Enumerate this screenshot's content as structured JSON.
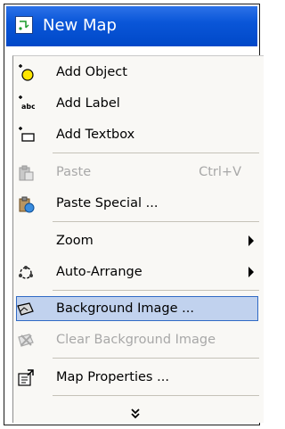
{
  "window": {
    "title": "New Map"
  },
  "menu": {
    "items": [
      {
        "label": "Add Object",
        "icon": "add-object-icon"
      },
      {
        "label": "Add Label",
        "icon": "add-label-icon"
      },
      {
        "label": "Add Textbox",
        "icon": "add-textbox-icon"
      },
      {
        "label": "Paste",
        "shortcut": "Ctrl+V",
        "icon": "paste-icon",
        "disabled": true
      },
      {
        "label": "Paste Special ...",
        "icon": "paste-special-icon"
      },
      {
        "label": "Zoom",
        "has_submenu": true
      },
      {
        "label": "Auto-Arrange",
        "icon": "auto-arrange-icon",
        "has_submenu": true
      },
      {
        "label": "Background Image ...",
        "icon": "background-image-icon",
        "highlighted": true
      },
      {
        "label": "Clear Background Image",
        "icon": "clear-background-icon",
        "disabled": true
      },
      {
        "label": "Map Properties ...",
        "icon": "map-properties-icon"
      }
    ],
    "more_icon": "chevron-double-down-icon"
  },
  "colors": {
    "title_bar": "#0a56d8",
    "highlight_fill": "#c1d2ee",
    "highlight_border": "#316ac5",
    "disabled_text": "#a8a8a8"
  }
}
